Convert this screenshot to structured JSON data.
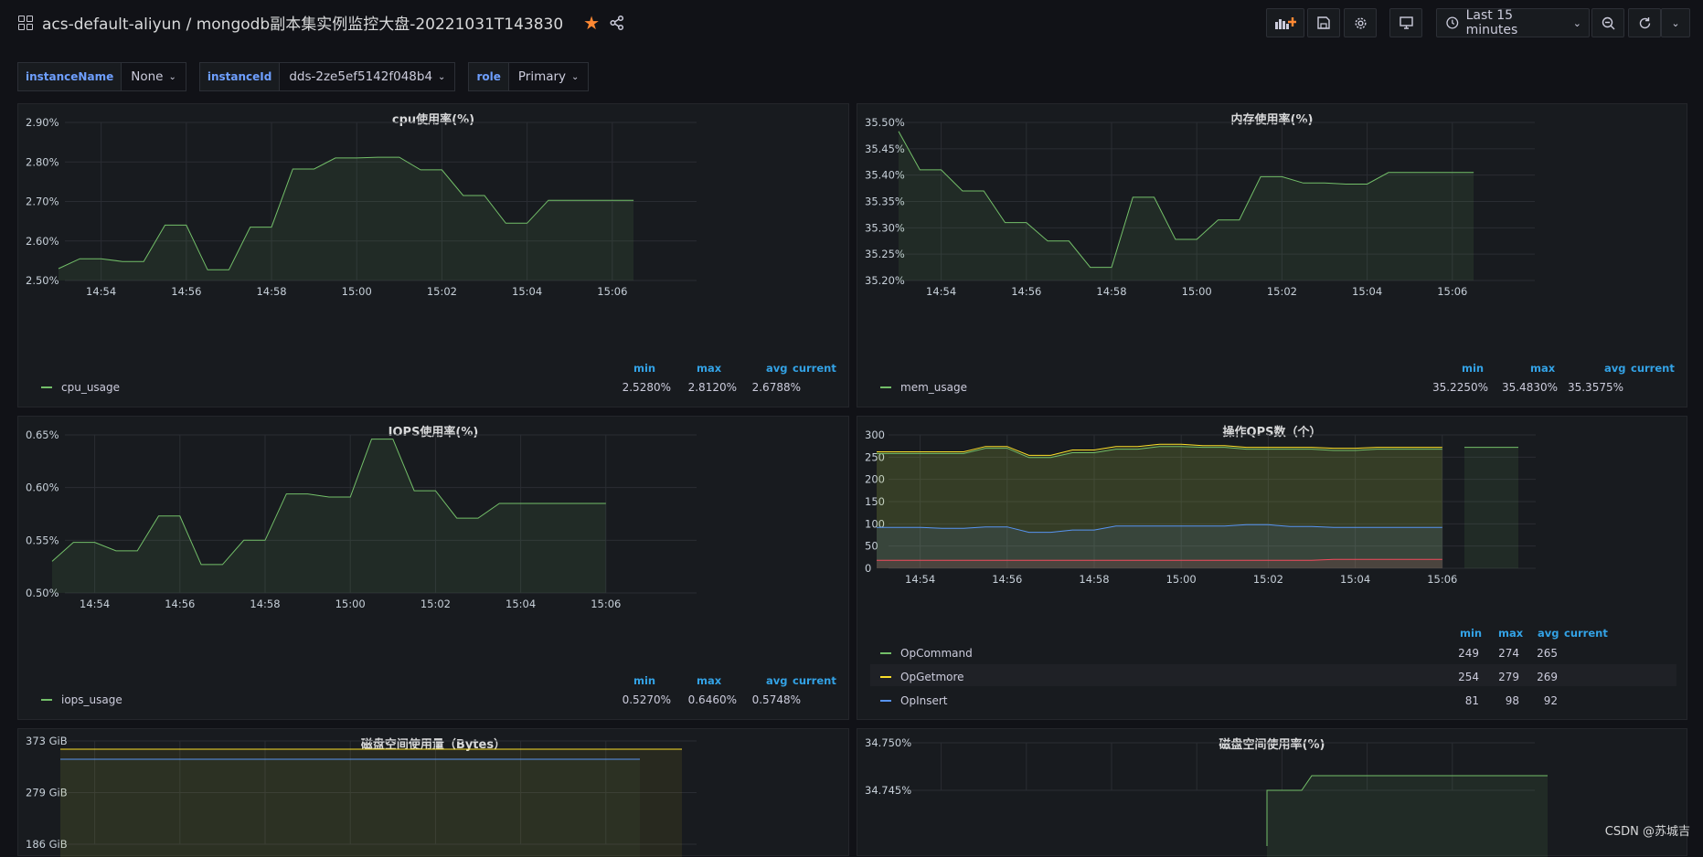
{
  "header": {
    "title": "acs-default-aliyun / mongodb副本集实例监控大盘-20221031T143830",
    "time_range": "Last 15 minutes"
  },
  "variables": [
    {
      "label": "instanceName",
      "value": "None"
    },
    {
      "label": "instanceId",
      "value": "dds-2ze5ef5142f048b4"
    },
    {
      "label": "role",
      "value": "Primary"
    }
  ],
  "legend_headers": {
    "min": "min",
    "max": "max",
    "avg": "avg",
    "current": "current"
  },
  "x_ticks": [
    "14:54",
    "14:56",
    "14:58",
    "15:00",
    "15:02",
    "15:04",
    "15:06"
  ],
  "panels": {
    "cpu": {
      "title": "cpu使用率(%)",
      "y_ticks": [
        "2.90%",
        "2.80%",
        "2.70%",
        "2.60%",
        "2.50%"
      ],
      "series": [
        {
          "name": "cpu_usage",
          "color": "#73bf69",
          "min": "2.5280%",
          "max": "2.8120%",
          "avg": "2.6788%",
          "current": ""
        }
      ]
    },
    "mem": {
      "title": "内存使用率(%)",
      "y_ticks": [
        "35.50%",
        "35.45%",
        "35.40%",
        "35.35%",
        "35.30%",
        "35.25%",
        "35.20%"
      ],
      "series": [
        {
          "name": "mem_usage",
          "color": "#73bf69",
          "min": "35.2250%",
          "max": "35.4830%",
          "avg": "35.3575%",
          "current": ""
        }
      ]
    },
    "iops": {
      "title": "IOPS使用率(%)",
      "y_ticks": [
        "0.65%",
        "0.60%",
        "0.55%",
        "0.50%"
      ],
      "series": [
        {
          "name": "iops_usage",
          "color": "#73bf69",
          "min": "0.5270%",
          "max": "0.6460%",
          "avg": "0.5748%",
          "current": ""
        }
      ]
    },
    "qps": {
      "title": "操作QPS数（个）",
      "y_ticks": [
        "300",
        "250",
        "200",
        "150",
        "100",
        "50",
        "0"
      ],
      "series": [
        {
          "name": "OpCommand",
          "color": "#73bf69",
          "min": "249",
          "max": "274",
          "avg": "265",
          "current": ""
        },
        {
          "name": "OpGetmore",
          "color": "#fade2a",
          "min": "254",
          "max": "279",
          "avg": "269",
          "current": ""
        },
        {
          "name": "OpInsert",
          "color": "#5794f2",
          "min": "81",
          "max": "98",
          "avg": "92",
          "current": ""
        }
      ]
    },
    "disk_bytes": {
      "title": "磁盘空间使用量（Bytes）",
      "y_ticks": [
        "373 GiB",
        "279 GiB",
        "186 GiB"
      ]
    },
    "disk_pct": {
      "title": "磁盘空间使用率(%)",
      "y_ticks": [
        "34.750%",
        "34.745%"
      ]
    }
  },
  "chart_data": [
    {
      "type": "line",
      "title": "cpu使用率(%)",
      "x": [
        "14:53",
        "14:53:30",
        "14:54",
        "14:54:30",
        "14:55",
        "14:55:30",
        "14:56",
        "14:56:30",
        "14:57",
        "14:57:30",
        "14:58",
        "14:58:30",
        "14:59",
        "14:59:30",
        "15:00",
        "15:00:30",
        "15:01",
        "15:01:30",
        "15:02",
        "15:02:30",
        "15:03",
        "15:03:30",
        "15:04",
        "15:04:30",
        "15:05",
        "15:05:30",
        "15:06",
        "15:06:30"
      ],
      "series": [
        {
          "name": "cpu_usage",
          "values": [
            2.53,
            2.555,
            2.555,
            2.548,
            2.548,
            2.64,
            2.64,
            2.527,
            2.527,
            2.635,
            2.635,
            2.782,
            2.782,
            2.81,
            2.81,
            2.812,
            2.812,
            2.78,
            2.78,
            2.715,
            2.715,
            2.645,
            2.645,
            2.703,
            2.703,
            2.703,
            2.703,
            2.703
          ]
        }
      ],
      "ylim": [
        2.5,
        2.9
      ]
    },
    {
      "type": "line",
      "title": "内存使用率(%)",
      "x": [
        "14:53",
        "14:53:30",
        "14:54",
        "14:54:30",
        "14:55",
        "14:55:30",
        "14:56",
        "14:56:30",
        "14:57",
        "14:57:30",
        "14:58",
        "14:58:30",
        "14:59",
        "14:59:30",
        "15:00",
        "15:00:30",
        "15:01",
        "15:01:30",
        "15:02",
        "15:02:30",
        "15:03",
        "15:03:30",
        "15:04",
        "15:04:30",
        "15:05",
        "15:05:30",
        "15:06",
        "15:06:30"
      ],
      "series": [
        {
          "name": "mem_usage",
          "values": [
            35.483,
            35.41,
            35.41,
            35.37,
            35.37,
            35.31,
            35.31,
            35.275,
            35.275,
            35.225,
            35.225,
            35.358,
            35.358,
            35.278,
            35.278,
            35.315,
            35.315,
            35.397,
            35.397,
            35.385,
            35.385,
            35.383,
            35.383,
            35.405,
            35.405,
            35.405,
            35.405,
            35.405
          ]
        }
      ],
      "ylim": [
        35.2,
        35.5
      ]
    },
    {
      "type": "line",
      "title": "IOPS使用率(%)",
      "x": [
        "14:53",
        "14:53:30",
        "14:54",
        "14:54:30",
        "14:55",
        "14:55:30",
        "14:56",
        "14:56:30",
        "14:57",
        "14:57:30",
        "14:58",
        "14:58:30",
        "14:59",
        "14:59:30",
        "15:00",
        "15:00:30",
        "15:01",
        "15:01:30",
        "15:02",
        "15:02:30",
        "15:03",
        "15:03:30",
        "15:04",
        "15:04:30",
        "15:05",
        "15:05:30",
        "15:06"
      ],
      "series": [
        {
          "name": "iops_usage",
          "values": [
            0.53,
            0.548,
            0.548,
            0.54,
            0.54,
            0.573,
            0.573,
            0.527,
            0.527,
            0.55,
            0.55,
            0.594,
            0.594,
            0.591,
            0.591,
            0.646,
            0.646,
            0.597,
            0.597,
            0.571,
            0.571,
            0.585,
            0.585,
            0.585,
            0.585,
            0.585,
            0.585
          ]
        }
      ],
      "ylim": [
        0.5,
        0.65
      ]
    },
    {
      "type": "line",
      "title": "操作QPS数（个）",
      "x": [
        "14:53",
        "14:53:30",
        "14:54",
        "14:54:30",
        "14:55",
        "14:55:30",
        "14:56",
        "14:56:30",
        "14:57",
        "14:57:30",
        "14:58",
        "14:58:30",
        "14:59",
        "14:59:30",
        "15:00",
        "15:00:30",
        "15:01",
        "15:01:30",
        "15:02",
        "15:02:30",
        "15:03",
        "15:03:30",
        "15:04",
        "15:04:30",
        "15:05",
        "15:05:30",
        "15:06"
      ],
      "series": [
        {
          "name": "OpCommand",
          "values": [
            258,
            258,
            258,
            258,
            258,
            270,
            270,
            249,
            249,
            260,
            260,
            268,
            268,
            274,
            274,
            272,
            272,
            268,
            268,
            268,
            268,
            265,
            265,
            268,
            268,
            268,
            268
          ]
        },
        {
          "name": "OpGetmore",
          "values": [
            262,
            262,
            262,
            262,
            262,
            274,
            274,
            254,
            254,
            266,
            266,
            274,
            274,
            279,
            279,
            276,
            276,
            272,
            272,
            272,
            272,
            270,
            270,
            272,
            272,
            272,
            272
          ]
        },
        {
          "name": "OpInsert",
          "values": [
            92,
            92,
            92,
            90,
            90,
            93,
            93,
            81,
            81,
            86,
            86,
            95,
            95,
            95,
            95,
            95,
            95,
            98,
            98,
            94,
            94,
            92,
            92,
            92,
            92,
            92,
            92
          ]
        },
        {
          "name": "",
          "values": [
            18,
            18,
            18,
            18,
            18,
            18,
            18,
            18,
            18,
            18,
            18,
            18,
            18,
            18,
            18,
            18,
            18,
            18,
            18,
            18,
            18,
            20,
            20,
            20,
            20,
            20,
            20
          ]
        }
      ],
      "ylim": [
        0,
        300
      ]
    }
  ],
  "watermark": "CSDN @苏城吉"
}
